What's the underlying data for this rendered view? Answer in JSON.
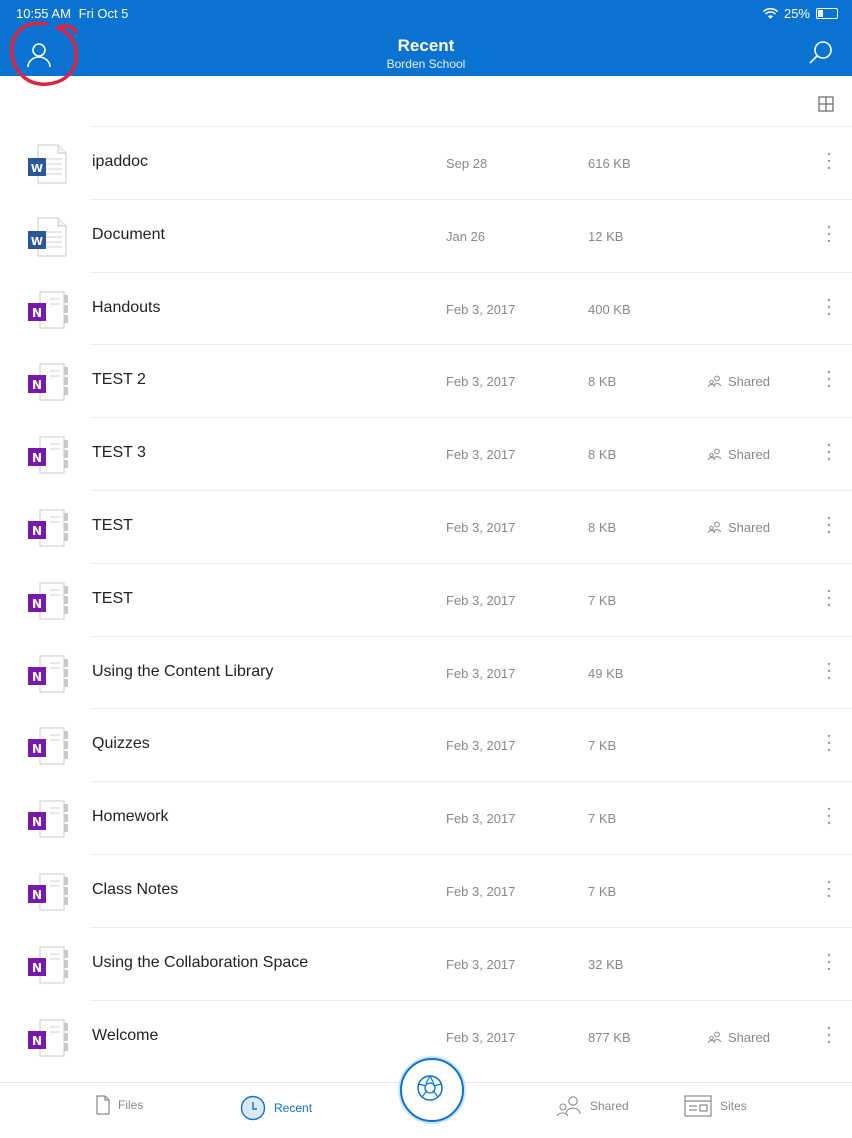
{
  "status": {
    "time": "10:55 AM",
    "date": "Fri Oct 5",
    "battery": "25%",
    "battery_level": 0.25
  },
  "header": {
    "title": "Recent",
    "subtitle": "Borden School"
  },
  "colors": {
    "accent": "#0a72d0",
    "word": "#2b579a",
    "onenote": "#7719aa",
    "annotation": "#e0243d"
  },
  "files": [
    {
      "type": "word",
      "name": "ipaddoc",
      "date": "Sep 28",
      "size": "616 KB",
      "shared": ""
    },
    {
      "type": "word",
      "name": "Document",
      "date": "Jan 26",
      "size": "12 KB",
      "shared": ""
    },
    {
      "type": "onenote",
      "name": "Handouts",
      "date": "Feb 3, 2017",
      "size": "400 KB",
      "shared": ""
    },
    {
      "type": "onenote",
      "name": "TEST 2",
      "date": "Feb 3, 2017",
      "size": "8 KB",
      "shared": "Shared"
    },
    {
      "type": "onenote",
      "name": "TEST 3",
      "date": "Feb 3, 2017",
      "size": "8 KB",
      "shared": "Shared"
    },
    {
      "type": "onenote",
      "name": "TEST",
      "date": "Feb 3, 2017",
      "size": "8 KB",
      "shared": "Shared"
    },
    {
      "type": "onenote",
      "name": "TEST",
      "date": "Feb 3, 2017",
      "size": "7 KB",
      "shared": ""
    },
    {
      "type": "onenote",
      "name": "Using the Content Library",
      "date": "Feb 3, 2017",
      "size": "49 KB",
      "shared": ""
    },
    {
      "type": "onenote",
      "name": "Quizzes",
      "date": "Feb 3, 2017",
      "size": "7 KB",
      "shared": ""
    },
    {
      "type": "onenote",
      "name": "Homework",
      "date": "Feb 3, 2017",
      "size": "7 KB",
      "shared": ""
    },
    {
      "type": "onenote",
      "name": "Class Notes",
      "date": "Feb 3, 2017",
      "size": "7 KB",
      "shared": ""
    },
    {
      "type": "onenote",
      "name": "Using the Collaboration Space",
      "date": "Feb 3, 2017",
      "size": "32 KB",
      "shared": ""
    },
    {
      "type": "onenote",
      "name": "Welcome",
      "date": "Feb 3, 2017",
      "size": "877 KB",
      "shared": "Shared"
    }
  ],
  "tabs": {
    "files": "Files",
    "recent": "Recent",
    "shared": "Shared",
    "sites": "Sites"
  }
}
